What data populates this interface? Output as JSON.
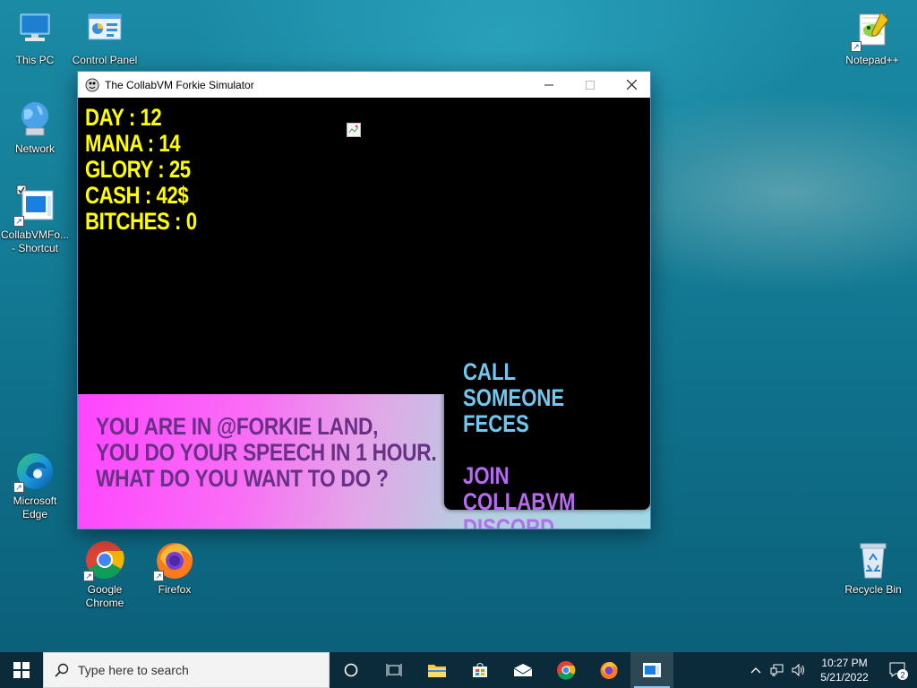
{
  "desktop": {
    "icons": [
      {
        "label": "This PC"
      },
      {
        "label": "Control Panel"
      },
      {
        "label": "Network"
      },
      {
        "label": "CollabVMFo...\n- Shortcut"
      },
      {
        "label": "Microsoft\nEdge"
      },
      {
        "label": "Google\nChrome"
      },
      {
        "label": "Firefox"
      },
      {
        "label": "Notepad++"
      },
      {
        "label": "Recycle Bin"
      }
    ]
  },
  "window": {
    "title": "The CollabVM Forkie Simulator",
    "stats": [
      "DAY : 12",
      "MANA : 14",
      "GLORY : 25",
      "CASH : 42$",
      "BITCHES : 0"
    ],
    "message": [
      "YOU ARE IN @FORKIE LAND,",
      "YOU DO YOUR SPEECH IN 1 HOUR.",
      "WHAT DO YOU WANT TO DO ?"
    ],
    "options": [
      "CALL SOMEONE\nFECES",
      "JOIN COLLABVM\nDISCORD"
    ]
  },
  "taskbar": {
    "search_placeholder": "Type here to search",
    "time": "10:27 PM",
    "date": "5/21/2022",
    "notification_count": "2"
  },
  "colors": {
    "stat_yellow": "#ffff00",
    "message_purple": "#6a2f86",
    "option_blue": "#6fc8f0",
    "option_purple": "#b66bf0"
  }
}
